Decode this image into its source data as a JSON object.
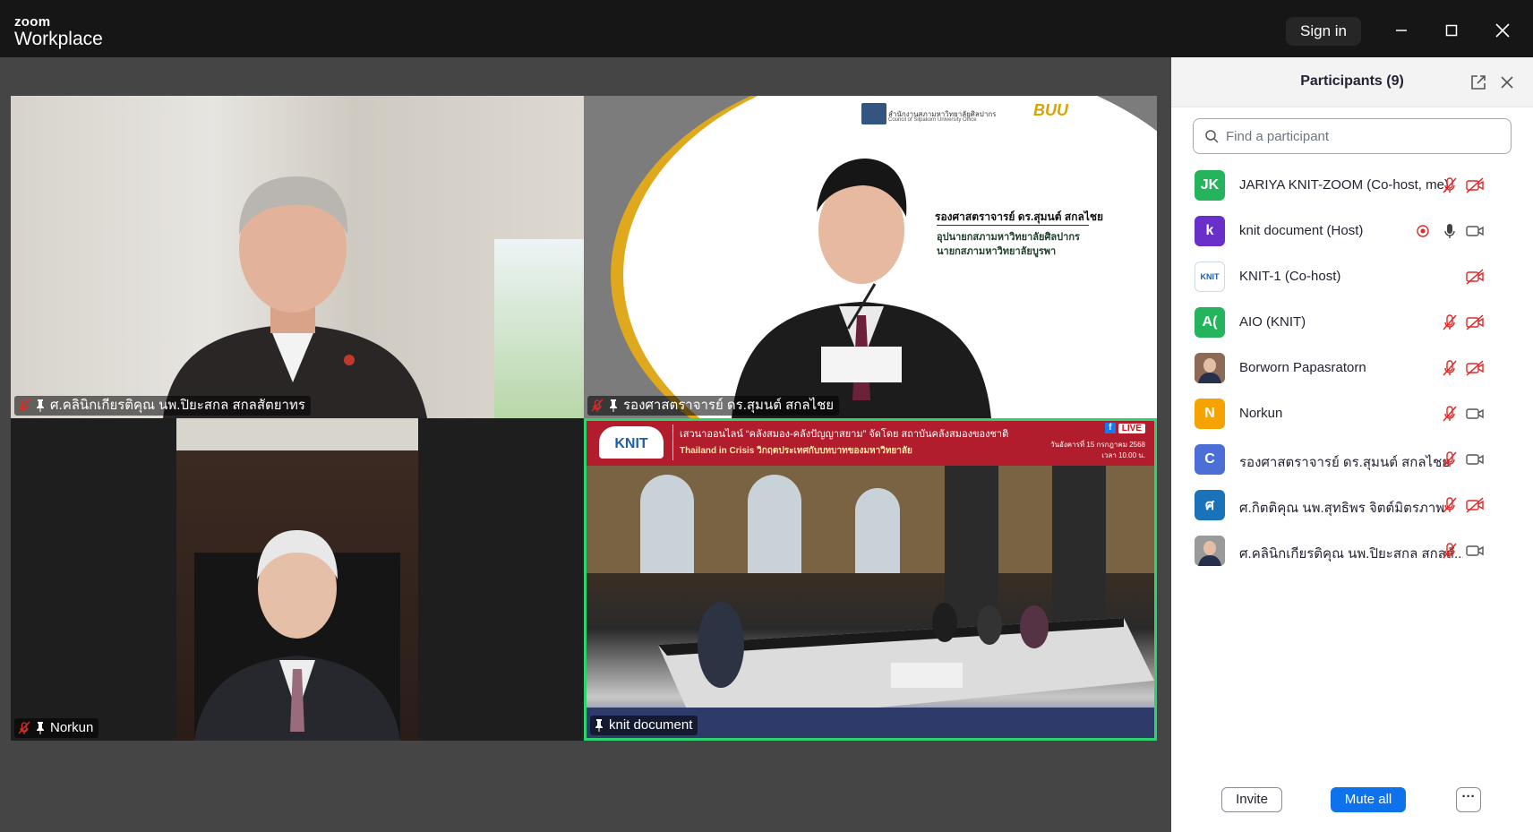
{
  "app": {
    "logo_top": "zoom",
    "logo_bottom": "Workplace",
    "signin_label": "Sign in"
  },
  "tiles": [
    {
      "name": "ศ.คลินิกเกียรติคุณ นพ.ปิยะสกล  สกลสัตยาทร"
    },
    {
      "name": "รองศาสตราจารย์ ดร.สุมนต์ สกลไชย",
      "slide": {
        "header_org": "สำนักงานสภามหาวิทยาลัยศิลปากร",
        "header_org_en": "Council of Silpakorn University Office",
        "header_logo": "BUU",
        "title": "รองศาสตราจารย์ ดร.สุมนต์ สกลไชย",
        "line1": "อุปนายกสภามหาวิทยาลัยศิลปากร",
        "line2": "นายกสภามหาวิทยาลัยบูรพา"
      }
    },
    {
      "name": "Norkun"
    },
    {
      "name": "knit document",
      "banner": {
        "logo": "KNIT",
        "line1": "เสวนาออนไลน์ “คลังสมอง-คลังปัญญาสยาม” จัดโดย สถาบันคลังสมองของชาติ",
        "line2": "Thailand in Crisis  วิกฤตประเทศกับบทบาทของมหาวิทยาลัย",
        "date": "วันอังคารที่ 15 กรกฎาคม 2568",
        "time": "เวลา 10.00 น.",
        "live": "LIVE"
      }
    }
  ],
  "panel": {
    "title": "Participants (9)",
    "search_placeholder": "Find a participant",
    "participants": [
      {
        "initials": "JK",
        "name": "JARIYA KNIT-ZOOM (Co-host, me)",
        "color": "#23b45c",
        "mic": "muted",
        "video": "off",
        "recording": false
      },
      {
        "initials": "k",
        "name": "knit document (Host)",
        "color": "#6b2fc9",
        "mic": "on",
        "video": "on",
        "recording": true
      },
      {
        "initials": "KNIT",
        "name": "KNIT-1 (Co-host)",
        "color": "#ffffff",
        "mic": "none",
        "video": "off",
        "recording": false
      },
      {
        "initials": "A(",
        "name": "AIO (KNIT)",
        "color": "#23b45c",
        "mic": "muted",
        "video": "off",
        "recording": false
      },
      {
        "initials": "",
        "name": "Borworn Papasratorn",
        "color": "#8c6a55",
        "mic": "muted",
        "video": "off",
        "recording": false
      },
      {
        "initials": "N",
        "name": "Norkun",
        "color": "#f5a300",
        "mic": "muted",
        "video": "on",
        "recording": false
      },
      {
        "initials": "C",
        "name": "รองศาสตราจารย์ ดร.สุมนต์ สกลไชย",
        "color": "#4b6fd6",
        "mic": "muted",
        "video": "on",
        "recording": false
      },
      {
        "initials": "ศ",
        "name": "ศ.กิตติคุณ นพ.สุทธิพร  จิตต์มิตรภาพ",
        "color": "#1a73b9",
        "mic": "muted",
        "video": "off",
        "recording": false
      },
      {
        "initials": "",
        "name": "ศ.คลินิกเกียรติคุณ นพ.ปิยะสกล  สกลสั...",
        "color": "#9a9a9a",
        "mic": "muted",
        "video": "on",
        "recording": false
      }
    ],
    "invite_label": "Invite",
    "mute_all_label": "Mute all",
    "more_label": "···"
  },
  "colors": {
    "accent": "#0e72ed",
    "muted_red": "#e02828",
    "speaker_border": "#2bd46c"
  }
}
